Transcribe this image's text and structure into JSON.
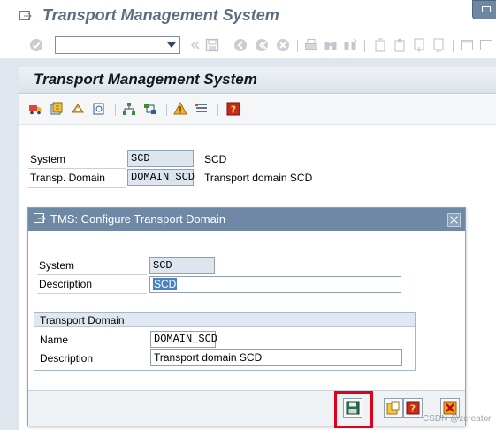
{
  "window": {
    "title": "Transport Management System"
  },
  "system_toolbar": {
    "command_field_value": "",
    "icons": [
      "check-icon",
      "dropdown-icon",
      "back-double-icon",
      "save-icon",
      "back-icon",
      "exit-icon",
      "cancel-icon",
      "print-icon",
      "find-icon",
      "find-next-icon",
      "first-page-icon",
      "previous-page-icon",
      "next-page-icon",
      "last-page-icon",
      "create-session-icon"
    ]
  },
  "panel": {
    "title": "Transport Management System",
    "toolbar_icons": [
      "truck-icon",
      "import-queue-icon",
      "transport-routes-icon",
      "overview-icon",
      "hierarchy-icon",
      "configuration-icon",
      "alert-icon",
      "list-icon",
      "help-icon"
    ]
  },
  "info": {
    "system_label": "System",
    "system_value": "SCD",
    "system_desc": "SCD",
    "domain_label": "Transp. Domain",
    "domain_value": "DOMAIN_SCD",
    "domain_desc": "Transport domain SCD"
  },
  "dialog": {
    "title": "TMS: Configure Transport Domain",
    "system_label": "System",
    "system_value": "SCD",
    "description_label": "Description",
    "description_value": "SCD",
    "group_title": "Transport Domain",
    "name_label": "Name",
    "name_value": "DOMAIN_SCD",
    "domain_description_label": "Description",
    "domain_description_value": "Transport domain SCD"
  },
  "colors": {
    "dialog_title_bar": "#6e88a6",
    "highlight_border": "#e0001a",
    "selection": "#4c82c2"
  },
  "watermark": "CSDN @zcreator"
}
